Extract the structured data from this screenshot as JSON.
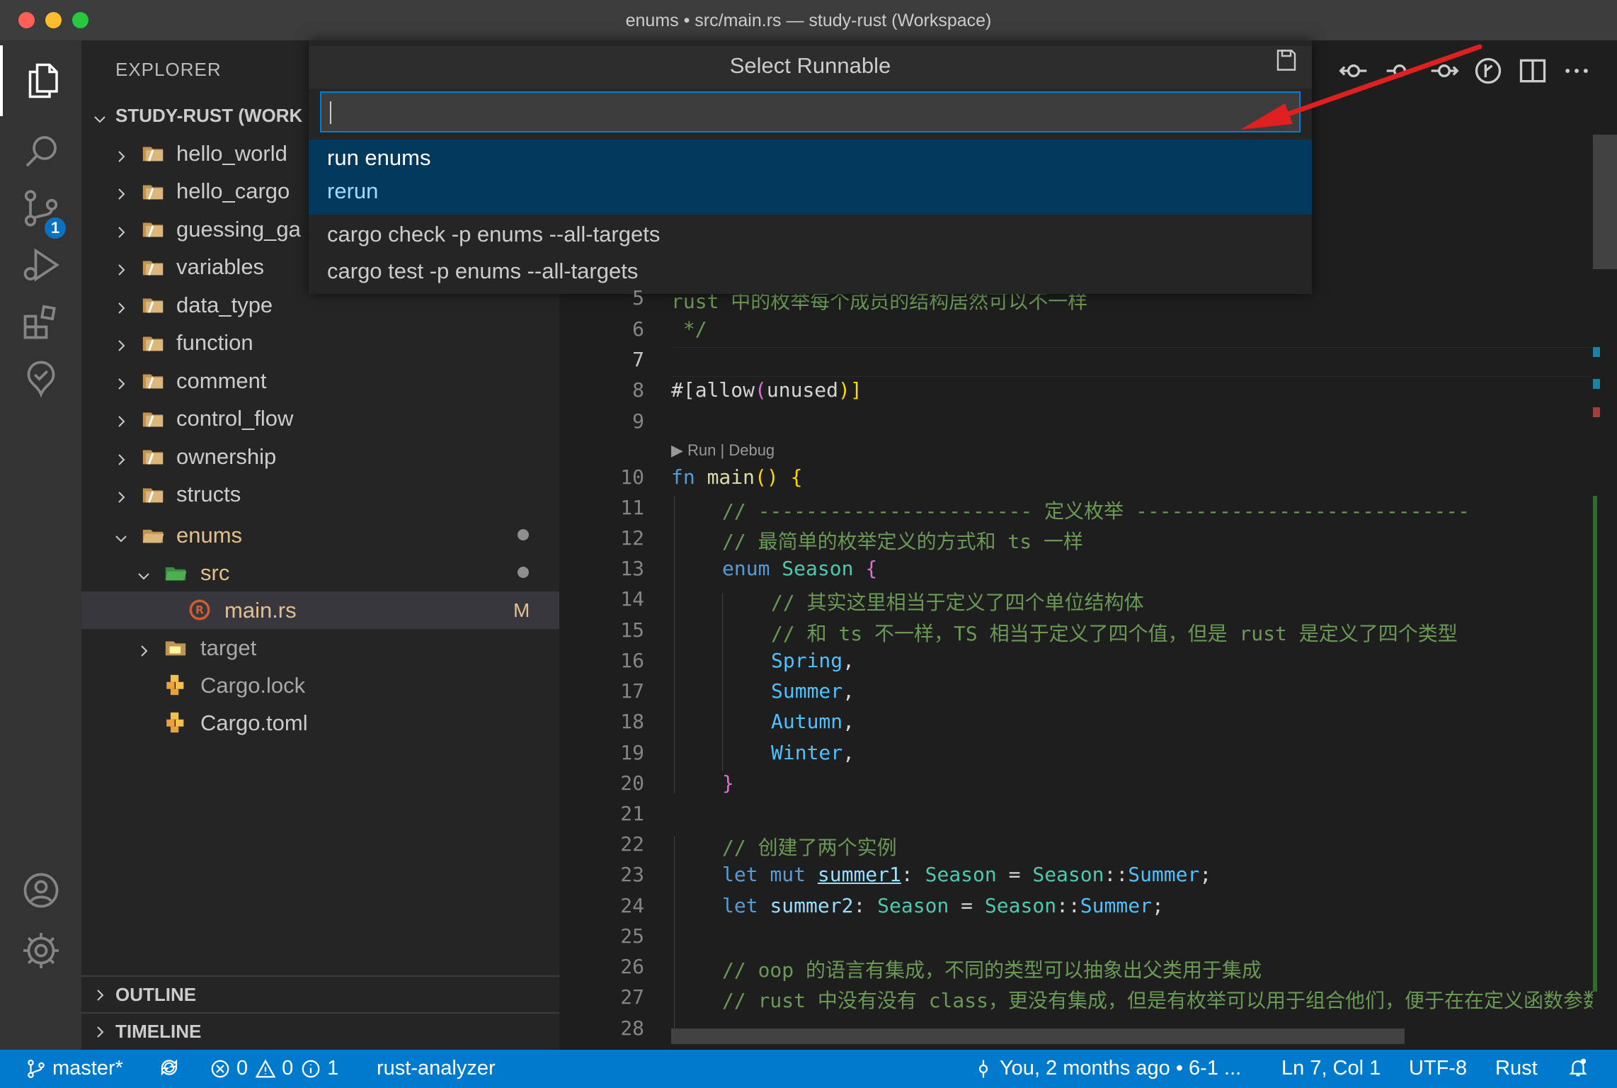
{
  "window": {
    "title": "enums • src/main.rs — study-rust (Workspace)"
  },
  "activity": {
    "scm_badge": "1"
  },
  "explorer": {
    "title": "EXPLORER",
    "workspace": "STUDY-RUST (WORK",
    "folders": [
      "hello_world",
      "hello_cargo",
      "guessing_ga",
      "variables",
      "data_type",
      "function",
      "comment",
      "control_flow",
      "ownership",
      "structs"
    ],
    "enums": "enums",
    "src": "src",
    "main_rs": "main.rs",
    "main_rs_status": "M",
    "target": "target",
    "cargo_lock": "Cargo.lock",
    "cargo_toml": "Cargo.toml",
    "outline": "OUTLINE",
    "timeline": "TIMELINE"
  },
  "palette": {
    "title": "Select Runnable",
    "input_value": "",
    "items": [
      {
        "label": "run enums",
        "detail": "rerun"
      },
      {
        "label": "cargo check -p enums --all-targets"
      },
      {
        "label": "cargo test -p enums --all-targets"
      }
    ]
  },
  "editor": {
    "codelens": "▶ Run | Debug",
    "line_numbers": [
      "5",
      "6",
      "7",
      "8",
      "9",
      "10",
      "11",
      "12",
      "13",
      "14",
      "15",
      "16",
      "17",
      "18",
      "19",
      "20",
      "21",
      "22",
      "23",
      "24",
      "25",
      "26",
      "27",
      "28"
    ],
    "line5": "rust 中的枚举每个成员的结构居然可以不一样",
    "line6": " */",
    "line8": [
      "#[",
      "allow",
      "(",
      "unused",
      ")]"
    ],
    "line10": [
      "fn ",
      "main",
      "() ",
      "{"
    ],
    "line11": "// ----------------------- 定义枚举 ----------------------------",
    "line12": "// 最简单的枚举定义的方式和 ts 一样",
    "line13": [
      "enum ",
      "Season ",
      "{"
    ],
    "line14": "// 其实这里相当于定义了四个单位结构体",
    "line15": "// 和 ts 不一样，TS 相当于定义了四个值，但是 rust 是定义了四个类型",
    "variants": [
      "Spring",
      "Summer",
      "Autumn",
      "Winter"
    ],
    "line20": "}",
    "line22": "// 创建了两个实例",
    "line23": [
      "let ",
      "mut ",
      "summer1",
      ": ",
      "Season",
      " = ",
      "Season",
      "::",
      "Summer",
      ";"
    ],
    "line24": [
      "let ",
      "summer2",
      ": ",
      "Season",
      " = ",
      "Season",
      "::",
      "Summer",
      ";"
    ],
    "line26": "// oop 的语言有集成，不同的类型可以抽象出父类用于集成",
    "line27": "// rust 中没有没有 class，更没有集成，但是有枚举可以用于组合他们，便于在在定义函数参数"
  },
  "status": {
    "branch": "master*",
    "errors": "0",
    "warnings": "0",
    "infos": "1",
    "extension": "rust-analyzer",
    "blame": "You, 2 months ago • 6-1 ...",
    "position": "Ln 7, Col 1",
    "encoding": "UTF-8",
    "language": "Rust"
  },
  "colors": {
    "statusbar": "#007acc",
    "selection": "#04395e",
    "accent_arrow": "#e02020"
  }
}
